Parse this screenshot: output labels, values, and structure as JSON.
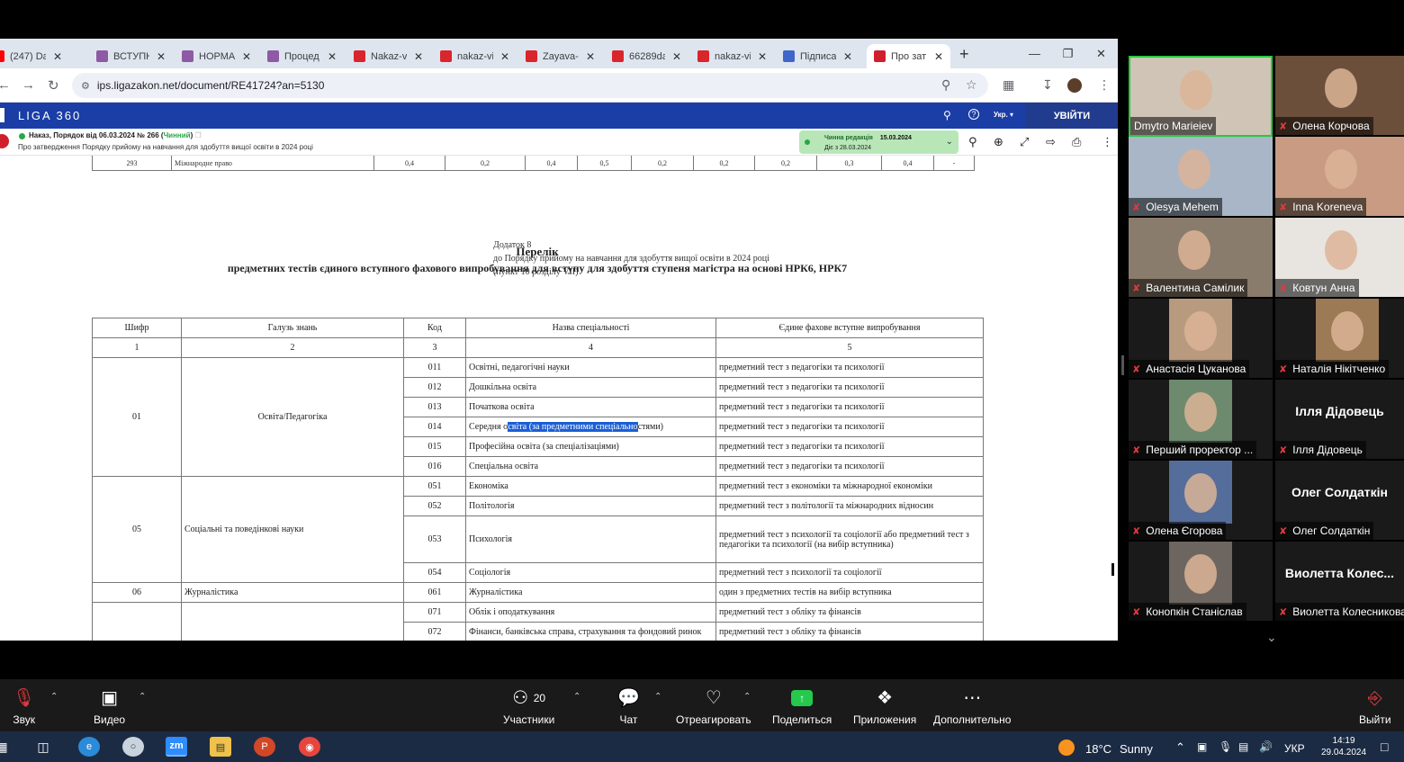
{
  "browser": {
    "tabs": [
      {
        "title": "(247) Da",
        "color": "#ff0000"
      },
      {
        "title": "ВСТУПН",
        "color": "#8e5aa6"
      },
      {
        "title": "НОРМА",
        "color": "#8e5aa6"
      },
      {
        "title": "Процед",
        "color": "#8e5aa6"
      },
      {
        "title": "Nakaz-v",
        "color": "#d9252c"
      },
      {
        "title": "nakaz-vi",
        "color": "#d9252c"
      },
      {
        "title": "Zayava-",
        "color": "#d9252c"
      },
      {
        "title": "66289da",
        "color": "#d9252c"
      },
      {
        "title": "nakaz-vi",
        "color": "#d9252c"
      },
      {
        "title": "Підписа",
        "color": "#3f67c9"
      },
      {
        "title": "Про зат",
        "color": "#d01f2c"
      }
    ],
    "new_tab_symbol": "+",
    "url": "ips.ligazakon.net/document/RE41724?an=5130"
  },
  "liga": {
    "logo": "LIGA 360",
    "lang": "Укр.",
    "login": "УВІЙТИ"
  },
  "doc_bar": {
    "title_prefix": "Наказ, Порядок від 06.03.2024 № 266 (",
    "status": "Чинний",
    "title_suffix": ")",
    "subtitle": "Про затвердження Порядку прийому на навчання для здобуття вищої освіти в 2024 році",
    "redaction_label": "Чинна редакція",
    "redaction_date": "15.03.2024",
    "redaction_since": "Діє з 28.03.2024"
  },
  "document": {
    "prev_row": [
      "293",
      "Міжнародне право",
      "0,4",
      "0,2",
      "0,4",
      "0,5",
      "0,2",
      "0,2",
      "0,2",
      "0,3",
      "0,4",
      "-"
    ],
    "addendum_lines": [
      "Додаток 8",
      "до Порядку прийому на навчання для здобуття вищої освіти в 2024 році",
      "(пункт 10 розділу VII)"
    ],
    "heading": "Перелік",
    "subheading": "предметних тестів єдиного вступного фахового випробування для вступу для здобуття ступеня магістра на основі НРК6, НРК7",
    "table_headers": [
      "Шифр",
      "Галузь знань",
      "Код",
      "Назва спеціальності",
      "Єдине фахове вступне випробування"
    ],
    "table_numbers": [
      "1",
      "2",
      "3",
      "4",
      "5"
    ],
    "groups": [
      {
        "code": "01",
        "field": "Освіта/Педагогіка",
        "rows": [
          {
            "code": "011",
            "name": "Освітні, педагогічні науки",
            "test": "предметний тест з педагогіки та психології"
          },
          {
            "code": "012",
            "name": "Дошкільна освіта",
            "test": "предметний тест з педагогіки та психології"
          },
          {
            "code": "013",
            "name": "Початкова освіта",
            "test": "предметний тест з педагогіки та психології"
          },
          {
            "code": "014",
            "name_pre": "Середня о",
            "name_sel": "світа (за предметними спеціально",
            "name_post": "стями)",
            "test": "предметний тест з педагогіки та психології"
          },
          {
            "code": "015",
            "name": "Професійна освіта (за спеціалізаціями)",
            "test": "предметний тест з педагогіки та психології"
          },
          {
            "code": "016",
            "name": "Спеціальна освіта",
            "test": "предметний тест з педагогіки та психології"
          }
        ]
      },
      {
        "code": "05",
        "field": "Соціальні та поведінкові науки",
        "rows": [
          {
            "code": "051",
            "name": "Економіка",
            "test": "предметний тест з економіки та міжнародної економіки"
          },
          {
            "code": "052",
            "name": "Політологія",
            "test": "предметний тест з політології та міжнародних відносин"
          },
          {
            "code": "053",
            "name": "Психологія",
            "test": "предметний тест з психології та соціології або предметний тест з педагогіки та психології (на вибір вступника)"
          },
          {
            "code": "054",
            "name": "Соціологія",
            "test": "предметний тест з психології та соціології"
          }
        ]
      },
      {
        "code": "06",
        "field": "Журналістика",
        "rows": [
          {
            "code": "061",
            "name": "Журналістика",
            "test": "один з предметних тестів на вибір вступника"
          }
        ]
      },
      {
        "code": "",
        "field": "",
        "rows": [
          {
            "code": "071",
            "name": "Облік і оподаткування",
            "test": "предметний тест з обліку та фінансів"
          },
          {
            "code": "072",
            "name": "Фінанси, банківська справа, страхування та фондовий ринок",
            "test": "предметний тест з обліку та фінансів"
          }
        ]
      }
    ]
  },
  "participants": [
    {
      "name": "Dmytro Marieiev",
      "muted": false,
      "video": true,
      "color": "#cfc4b5"
    },
    {
      "name": "Олена Корчова",
      "muted": true,
      "video": true,
      "color": "#6b4f3a"
    },
    {
      "name": "Olesya Mehem",
      "muted": true,
      "video": true,
      "color": "#a9b6c8"
    },
    {
      "name": "Inna Koreneva",
      "muted": true,
      "video": true,
      "color": "#c89b82"
    },
    {
      "name": "Валентина Самілик",
      "muted": true,
      "video": true,
      "color": "#8a7c6c"
    },
    {
      "name": "Ковтун Анна",
      "muted": true,
      "video": true,
      "color": "#e8e4e0"
    },
    {
      "name": "Анастасія Цуканова",
      "muted": true,
      "video": true,
      "color": "#b89b7e"
    },
    {
      "name": "Наталія Нікітченко",
      "muted": true,
      "video": true,
      "color": "#9c7a55"
    },
    {
      "name": "Перший проректор ...",
      "muted": true,
      "video": true,
      "color": "#6e8a6e"
    },
    {
      "name": "Ілля Дідовець",
      "muted": true,
      "video": false,
      "big": "Ілля Дідовець"
    },
    {
      "name": "Олена Єгорова",
      "muted": true,
      "video": true,
      "color": "#556d9a"
    },
    {
      "name": "Олег Солдаткін",
      "muted": true,
      "video": false,
      "big": "Олег Солдаткін"
    },
    {
      "name": "Конопкін Станіслав",
      "muted": true,
      "video": true,
      "color": "#6d6660"
    },
    {
      "name": "Виолетта Колесникова",
      "muted": true,
      "video": false,
      "big": "Виолетта  Колес..."
    }
  ],
  "zoom_bar": {
    "audio": "Звук",
    "video": "Видео",
    "participants": "Участники",
    "participants_count": "20",
    "chat": "Чат",
    "react": "Отреагировать",
    "share": "Поделиться",
    "apps": "Приложения",
    "more": "Дополнительно",
    "leave": "Выйти"
  },
  "taskbar": {
    "weather_temp": "18°C",
    "weather_text": "Sunny",
    "lang": "УКР",
    "time": "14:19",
    "date": "29.04.2024",
    "zoom_app": "zm"
  },
  "colors": {
    "liga_blue": "#1a3ea5",
    "selection": "#1c5fd3",
    "active_green": "#27a844",
    "zoom_share": "#25c94c",
    "muted_red": "#e0393e"
  }
}
